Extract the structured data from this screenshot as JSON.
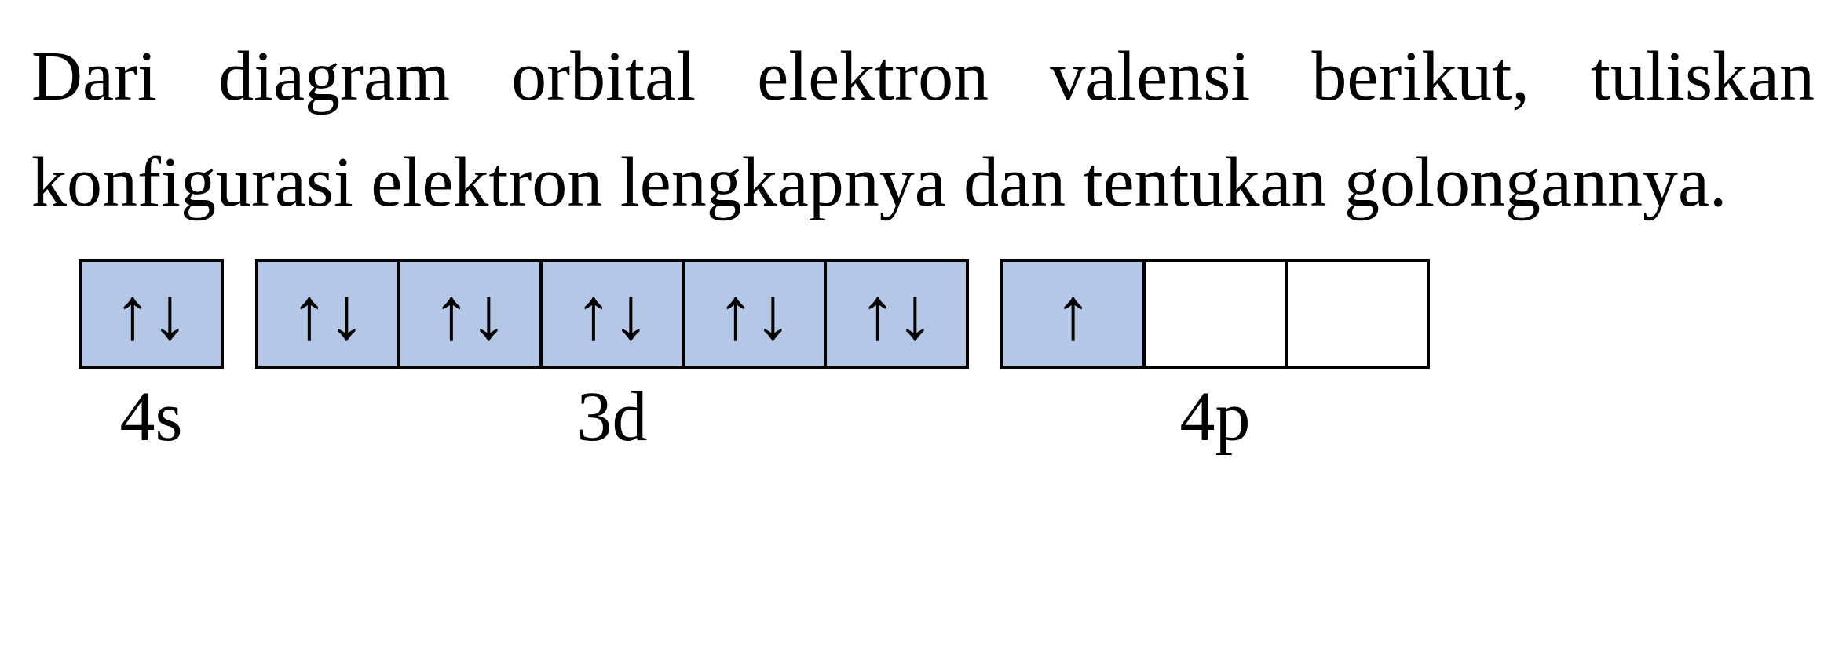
{
  "question": {
    "text": "Dari diagram orbital elektron valensi berikut, tuliskan konfigurasi elektron lengkapnya dan tentukan golongannya."
  },
  "chart_data": {
    "type": "table",
    "description": "Electron orbital diagram showing valence electrons",
    "orbitals": [
      {
        "label": "4s",
        "boxes": [
          {
            "filled": true,
            "electrons": "up-down"
          }
        ]
      },
      {
        "label": "3d",
        "boxes": [
          {
            "filled": true,
            "electrons": "up-down"
          },
          {
            "filled": true,
            "electrons": "up-down"
          },
          {
            "filled": true,
            "electrons": "up-down"
          },
          {
            "filled": true,
            "electrons": "up-down"
          },
          {
            "filled": true,
            "electrons": "up-down"
          }
        ]
      },
      {
        "label": "4p",
        "boxes": [
          {
            "filled": true,
            "electrons": "up"
          },
          {
            "filled": false,
            "electrons": "none"
          },
          {
            "filled": false,
            "electrons": "none"
          }
        ]
      }
    ]
  },
  "arrows": {
    "up": "↑",
    "down": "↓",
    "updown": "↑↓"
  }
}
